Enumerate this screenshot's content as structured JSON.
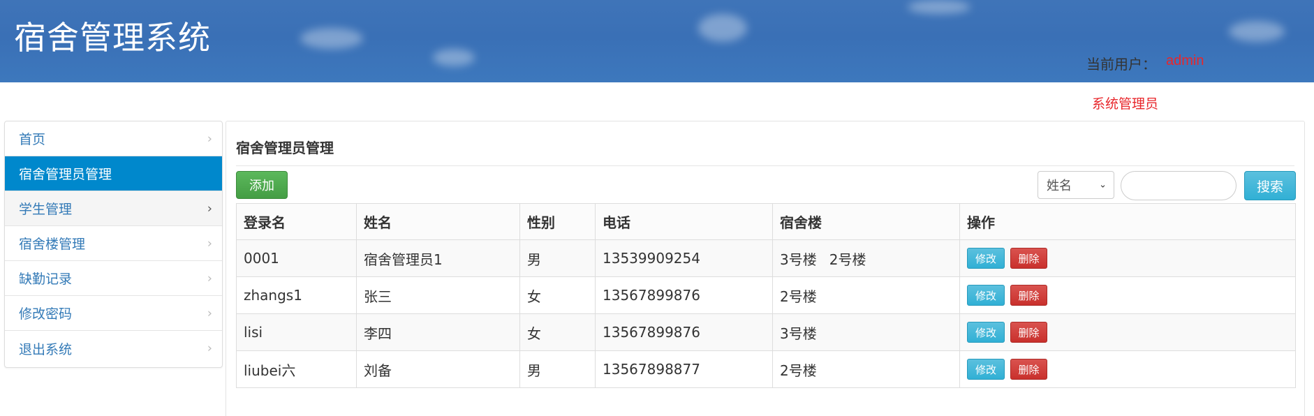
{
  "header": {
    "title": "宿舍管理系统",
    "user_label": "当前用户：",
    "user_name": "admin",
    "user_role": "系统管理员"
  },
  "sidebar": {
    "items": [
      {
        "label": "首页"
      },
      {
        "label": "宿舍管理员管理"
      },
      {
        "label": "学生管理"
      },
      {
        "label": "宿舍楼管理"
      },
      {
        "label": "缺勤记录"
      },
      {
        "label": "修改密码"
      },
      {
        "label": "退出系统"
      }
    ],
    "active_index": 1,
    "hover_index": 2
  },
  "main": {
    "title": "宿舍管理员管理",
    "add_label": "添加",
    "search_field_selected": "姓名",
    "search_value": "",
    "search_label": "搜索",
    "table": {
      "columns": [
        "登录名",
        "姓名",
        "性别",
        "电话",
        "宿舍楼",
        "操作"
      ],
      "rows": [
        {
          "login": "0001",
          "name": "宿舍管理员1",
          "gender": "男",
          "phone": "13539909254",
          "buildings": [
            "3号楼",
            "2号楼"
          ]
        },
        {
          "login": "zhangs1",
          "name": "张三",
          "gender": "女",
          "phone": "13567899876",
          "buildings": [
            "2号楼"
          ]
        },
        {
          "login": "lisi",
          "name": "李四",
          "gender": "女",
          "phone": "13567899876",
          "buildings": [
            "3号楼"
          ]
        },
        {
          "login": "liubei六",
          "name": "刘备",
          "gender": "男",
          "phone": "13567898877",
          "buildings": [
            "2号楼"
          ]
        }
      ],
      "edit_label": "修改",
      "delete_label": "删除"
    }
  },
  "colors": {
    "header_bg": "#3d74b9",
    "active_nav": "#0088cc",
    "add_btn": "#5cb85c",
    "info_btn": "#5bc0de",
    "danger_btn": "#d9534f",
    "user_highlight": "#e8262b"
  },
  "icons": {
    "nav_arrow": "chevron-right-icon",
    "select_arrow": "chevron-down-icon"
  }
}
